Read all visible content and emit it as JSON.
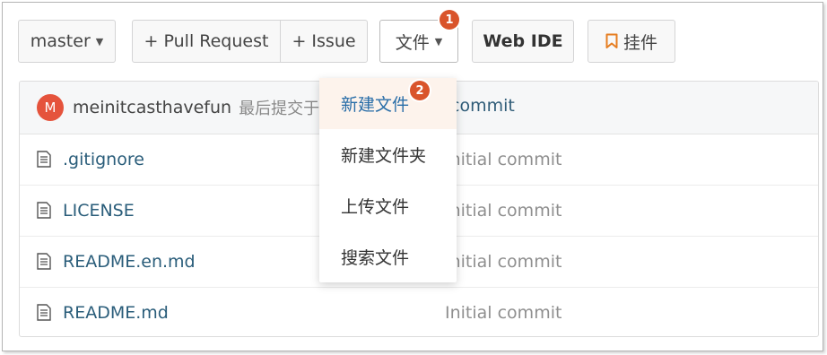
{
  "toolbar": {
    "branch": "master",
    "pull_request": "+ Pull Request",
    "issue": "+ Issue",
    "file_menu": "文件",
    "web_ide": "Web IDE",
    "plugin": "挂件",
    "badge1": "1"
  },
  "commit": {
    "avatar_letter": "M",
    "author": "meinitcasthavefun",
    "text": "最后提交于",
    "message": "commit"
  },
  "files": [
    {
      "name": ".gitignore",
      "commit": "Initial commit"
    },
    {
      "name": "LICENSE",
      "commit": "Initial commit"
    },
    {
      "name": "README.en.md",
      "commit": "Initial commit"
    },
    {
      "name": "README.md",
      "commit": "Initial commit"
    }
  ],
  "dropdown": {
    "items": [
      "新建文件",
      "新建文件夹",
      "上传文件",
      "搜索文件"
    ],
    "badge2": "2"
  },
  "colors": {
    "badge": "#d9542b",
    "accent": "#e67e22",
    "link": "#2a5d7a"
  }
}
